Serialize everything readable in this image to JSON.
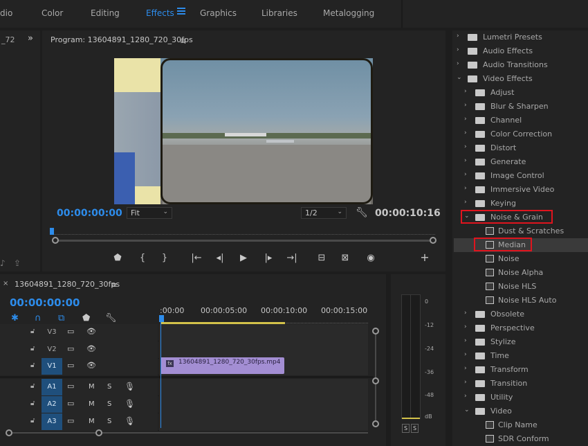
{
  "workspaces": {
    "cut_prefix": "dio",
    "tabs": [
      "Color",
      "Editing",
      "Effects",
      "Graphics",
      "Libraries",
      "Metalogging"
    ],
    "active": "Effects"
  },
  "left_stub": {
    "label": "_72",
    "expand": "»"
  },
  "program": {
    "title": "Program: 13604891_1280_720_30fps",
    "menu": "≡",
    "timecode_current": "00:00:00:00",
    "timecode_duration": "00:00:10:16",
    "fit": "Fit",
    "resolution": "1/2",
    "transport": [
      "marker",
      "in",
      "out",
      "go-to-in",
      "step-back",
      "play",
      "step-forward",
      "go-to-out",
      "lift",
      "extract",
      "export-frame",
      "add"
    ]
  },
  "timeline": {
    "close": "×",
    "title": "13604891_1280_720_30fps",
    "menu": "≡",
    "timecode": "00:00:00:00",
    "ruler": [
      ":00:00",
      "00:00:05:00",
      "00:00:10:00",
      "00:00:15:00"
    ],
    "video_tracks": [
      "V3",
      "V2",
      "V1"
    ],
    "audio_tracks": [
      "A1",
      "A2",
      "A3"
    ],
    "track_m": "M",
    "track_s": "S",
    "clip_label": "13604891_1280_720_30fps.mp4",
    "clip_fx": "fx"
  },
  "meter": {
    "scale": [
      "0",
      "-12",
      "-24",
      "-36",
      "-48",
      "dB"
    ],
    "solo_left": "S",
    "solo_right": "S"
  },
  "effects_tree": [
    {
      "label": "Lumetri Presets",
      "level": 0,
      "state": "closed",
      "kind": "folder"
    },
    {
      "label": "Audio Effects",
      "level": 0,
      "state": "closed",
      "kind": "folder"
    },
    {
      "label": "Audio Transitions",
      "level": 0,
      "state": "closed",
      "kind": "folder"
    },
    {
      "label": "Video Effects",
      "level": 0,
      "state": "open",
      "kind": "folder"
    },
    {
      "label": "Adjust",
      "level": 1,
      "state": "closed",
      "kind": "folder"
    },
    {
      "label": "Blur & Sharpen",
      "level": 1,
      "state": "closed",
      "kind": "folder"
    },
    {
      "label": "Channel",
      "level": 1,
      "state": "closed",
      "kind": "folder"
    },
    {
      "label": "Color Correction",
      "level": 1,
      "state": "closed",
      "kind": "folder"
    },
    {
      "label": "Distort",
      "level": 1,
      "state": "closed",
      "kind": "folder"
    },
    {
      "label": "Generate",
      "level": 1,
      "state": "closed",
      "kind": "folder"
    },
    {
      "label": "Image Control",
      "level": 1,
      "state": "closed",
      "kind": "folder"
    },
    {
      "label": "Immersive Video",
      "level": 1,
      "state": "closed",
      "kind": "folder"
    },
    {
      "label": "Keying",
      "level": 1,
      "state": "closed",
      "kind": "folder"
    },
    {
      "label": "Noise & Grain",
      "level": 1,
      "state": "open",
      "kind": "folder",
      "highlight": true
    },
    {
      "label": "Dust & Scratches",
      "level": 2,
      "kind": "effect"
    },
    {
      "label": "Median",
      "level": 2,
      "kind": "effect",
      "selected": true,
      "highlight": true
    },
    {
      "label": "Noise",
      "level": 2,
      "kind": "effect"
    },
    {
      "label": "Noise Alpha",
      "level": 2,
      "kind": "effect"
    },
    {
      "label": "Noise HLS",
      "level": 2,
      "kind": "effect"
    },
    {
      "label": "Noise HLS Auto",
      "level": 2,
      "kind": "effect"
    },
    {
      "label": "Obsolete",
      "level": 1,
      "state": "closed",
      "kind": "folder"
    },
    {
      "label": "Perspective",
      "level": 1,
      "state": "closed",
      "kind": "folder"
    },
    {
      "label": "Stylize",
      "level": 1,
      "state": "closed",
      "kind": "folder"
    },
    {
      "label": "Time",
      "level": 1,
      "state": "closed",
      "kind": "folder"
    },
    {
      "label": "Transform",
      "level": 1,
      "state": "closed",
      "kind": "folder"
    },
    {
      "label": "Transition",
      "level": 1,
      "state": "closed",
      "kind": "folder"
    },
    {
      "label": "Utility",
      "level": 1,
      "state": "closed",
      "kind": "folder"
    },
    {
      "label": "Video",
      "level": 1,
      "state": "open",
      "kind": "folder"
    },
    {
      "label": "Clip Name",
      "level": 2,
      "kind": "effect"
    },
    {
      "label": "SDR Conform",
      "level": 2,
      "kind": "effect"
    }
  ],
  "colors": {
    "accent": "#2d8ceb",
    "highlight_box": "#e0141e",
    "clip": "#a38ed3",
    "workarea": "#d3c24a"
  }
}
